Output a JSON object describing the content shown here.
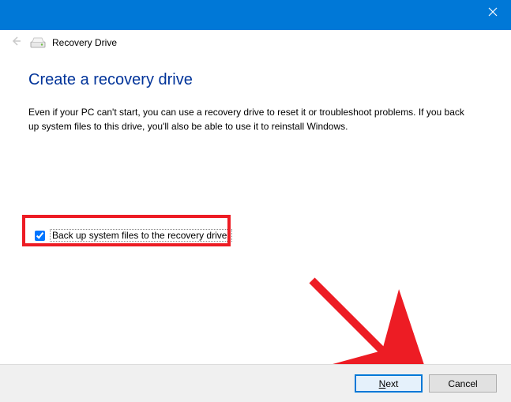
{
  "titlebar": {
    "app_title": "Recovery Drive"
  },
  "content": {
    "heading": "Create a recovery drive",
    "description": "Even if your PC can't start, you can use a recovery drive to reset it or troubleshoot problems. If you back up system files to this drive, you'll also be able to use it to reinstall Windows."
  },
  "checkbox": {
    "label": "Back up system files to the recovery drive.",
    "checked": true
  },
  "buttons": {
    "next_prefix": "N",
    "next_rest": "ext",
    "cancel": "Cancel"
  }
}
